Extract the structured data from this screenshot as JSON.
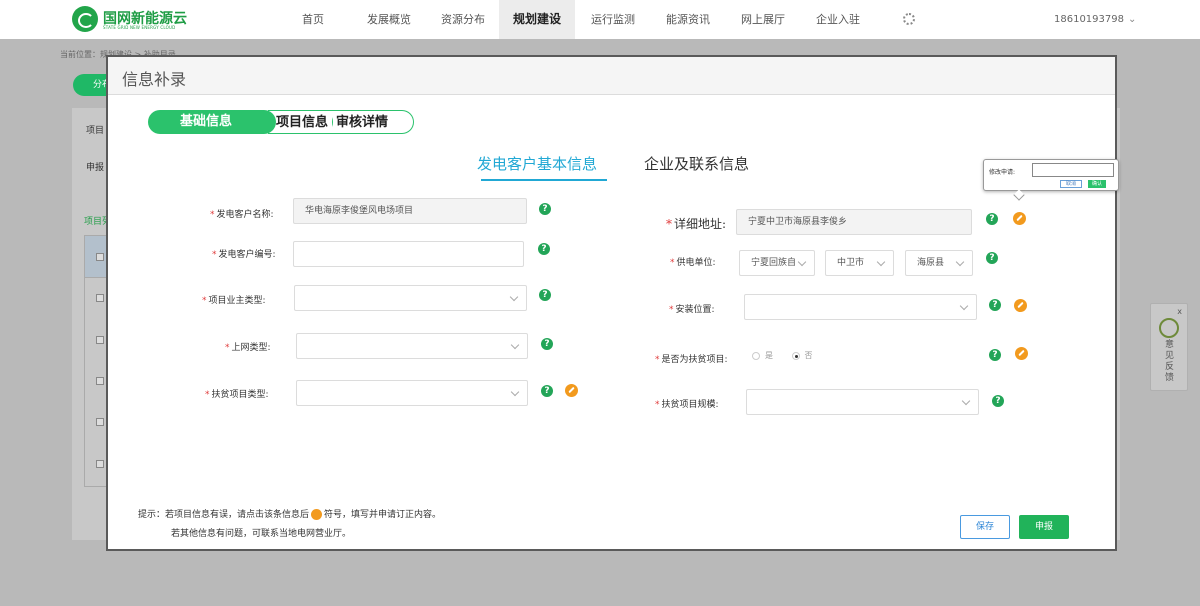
{
  "header": {
    "logo_text": "国网新能源云",
    "logo_subtext": "STATE GRID NEW ENERGY CLOUD",
    "nav": [
      "首页",
      "发展概览",
      "资源分布",
      "规划建设",
      "运行监测",
      "能源资讯",
      "网上展厅",
      "企业入驻"
    ],
    "active_nav": "规划建设",
    "user": "18610193798"
  },
  "background": {
    "breadcrumb": "当前位置：规划建设 > 补助目录",
    "green_button": "分布",
    "row_label_1": "项目",
    "row_label_2": "申报",
    "section_label": "项目列"
  },
  "feedback": {
    "close": "x",
    "label": "意见反馈"
  },
  "modal": {
    "title": "信息补录",
    "steps": [
      "基础信息",
      "项目信息",
      "审核详情"
    ],
    "section_active": "发电客户基本信息",
    "section_other": "企业及联系信息",
    "left_fields": {
      "customer_name_label": "发电客户名称:",
      "customer_name_value": "华电海原李俊堡风电场项目",
      "customer_no_label": "发电客户编号:",
      "customer_no_value": "",
      "owner_type_label": "项目业主类型:",
      "owner_type_value": "",
      "grid_type_label": "上网类型:",
      "grid_type_value": "",
      "poverty_type_label": "扶贫项目类型:",
      "poverty_type_value": ""
    },
    "right_fields": {
      "address_label": "详细地址:",
      "address_value": "宁夏中卫市海原县李俊乡",
      "supply_unit_label": "供电单位:",
      "supply_province": "宁夏回族自",
      "supply_city": "中卫市",
      "supply_county": "海原县",
      "install_label": "安装位置:",
      "install_value": "",
      "is_poverty_label": "是否为扶贫项目:",
      "yes_option": "是",
      "no_option": "否",
      "selected_option": "否",
      "poverty_scale_label": "扶贫项目规模:",
      "poverty_scale_value": ""
    },
    "help_glyph": "?",
    "popover": {
      "label": "修改申请:",
      "cancel": "取消",
      "confirm": "确认"
    },
    "tip": {
      "line1_prefix": "提示：若项目信息有误，请点击该条信息后",
      "line1_suffix": "符号，填写并申请订正内容。",
      "line2": "若其他信息有问题，可联系当地电网营业厅。"
    },
    "buttons": {
      "save": "保存",
      "submit": "申报"
    }
  },
  "colors": {
    "primary_green": "#2bc26c",
    "accent_blue": "#21a8d4",
    "edit_orange": "#f29a1e",
    "required_red": "#e03c3c"
  }
}
